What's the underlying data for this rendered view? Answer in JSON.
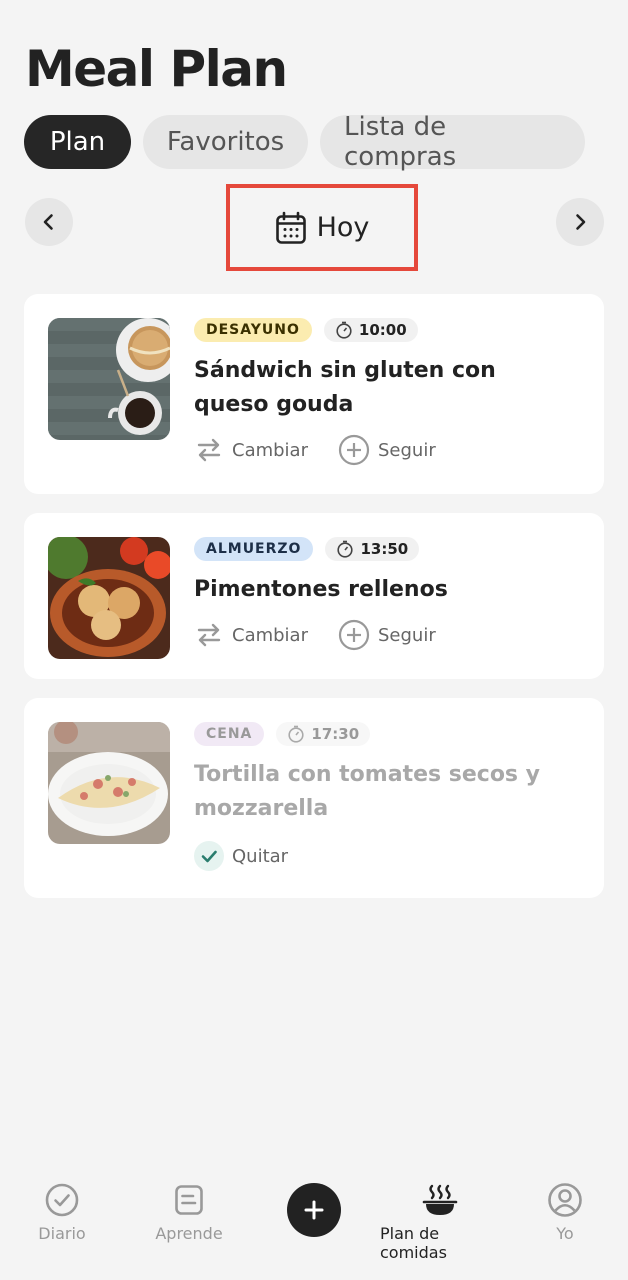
{
  "header": {
    "title": "Meal Plan"
  },
  "tabs": [
    {
      "label": "Plan",
      "active": true
    },
    {
      "label": "Favoritos",
      "active": false
    },
    {
      "label": "Lista de compras",
      "active": false
    }
  ],
  "date_nav": {
    "label": "Hoy",
    "prev_icon": "chevron-left-icon",
    "next_icon": "chevron-right-icon",
    "calendar_icon": "calendar-icon"
  },
  "meals": [
    {
      "type": "DESAYUNO",
      "badge_bg": "#fbecb0",
      "badge_color": "#3a3000",
      "time": "10:00",
      "name": "Sándwich sin gluten con queso gouda",
      "actions": [
        "Cambiar",
        "Seguir"
      ]
    },
    {
      "type": "ALMUERZO",
      "badge_bg": "#d3e4f8",
      "badge_color": "#1d2f48",
      "time": "13:50",
      "name": "Pimentones rellenos",
      "actions": [
        "Cambiar",
        "Seguir"
      ]
    },
    {
      "type": "CENA",
      "badge_bg": "#f1e9f5",
      "badge_color": "#999999",
      "time": "17:30",
      "name": "Tortilla con tomates secos y mozzarella",
      "actions": [
        "Quitar"
      ],
      "done": true
    }
  ],
  "bottom_nav": [
    {
      "label": "Diario",
      "icon": "check-circle-icon",
      "active": false
    },
    {
      "label": "Aprende",
      "icon": "document-icon",
      "active": false
    },
    {
      "label": "",
      "icon": "plus-icon",
      "active": false
    },
    {
      "label": "Plan de comidas",
      "icon": "bowl-icon",
      "active": true
    },
    {
      "label": "Yo",
      "icon": "user-icon",
      "active": false
    }
  ],
  "colors": {
    "background": "#f4f4f4",
    "dark": "#262626",
    "highlight_border": "#e5483b",
    "check": "#2a7d6e"
  }
}
